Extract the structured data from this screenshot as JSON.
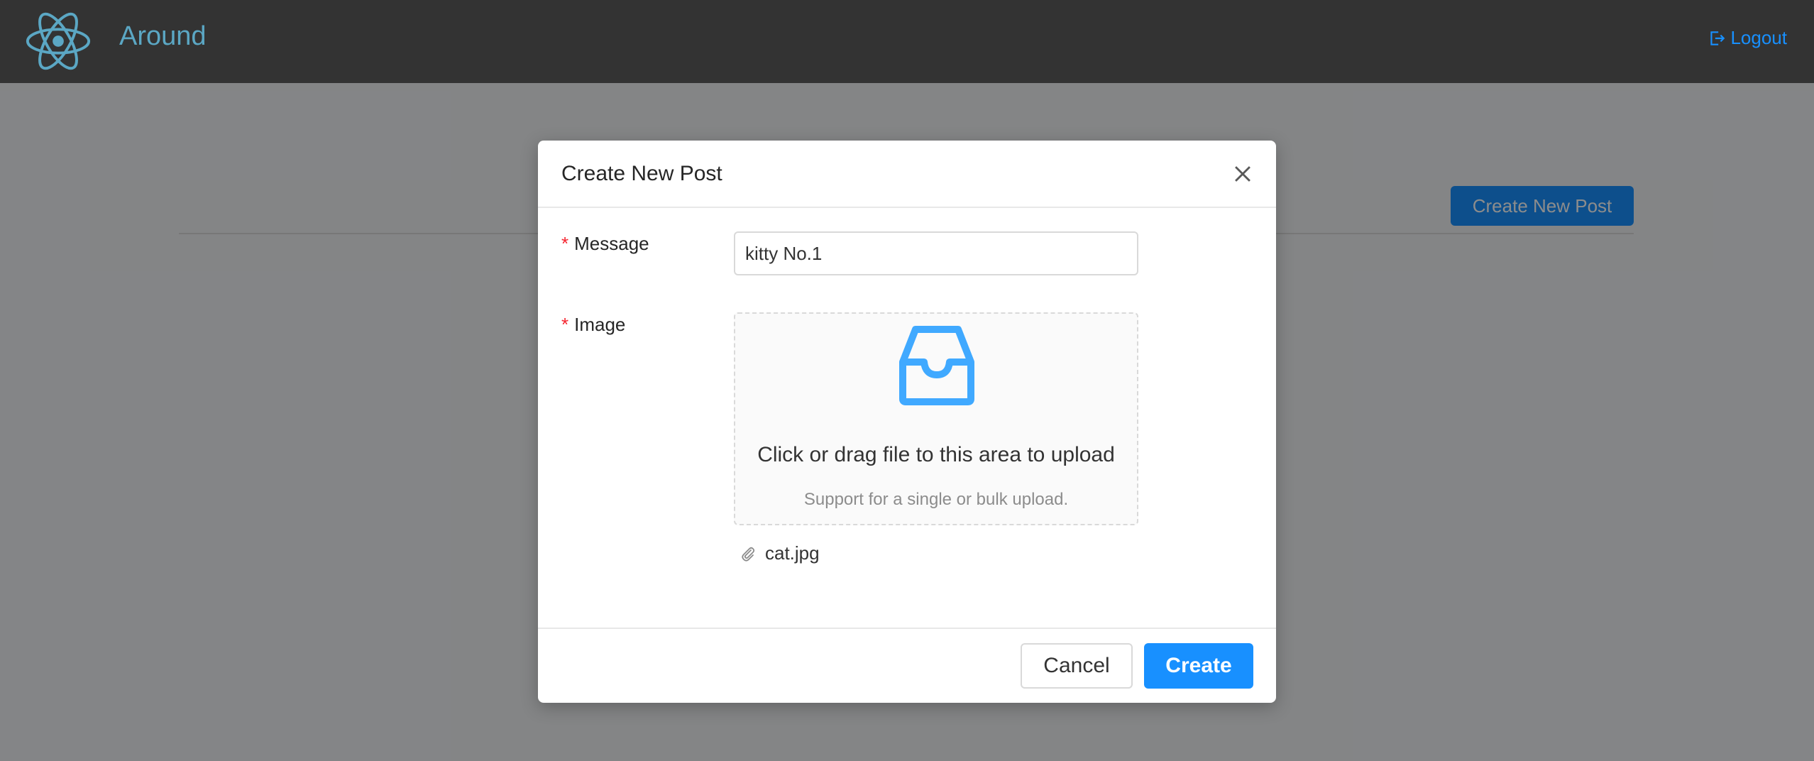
{
  "header": {
    "app_title": "Around",
    "logout_label": "Logout"
  },
  "page": {
    "create_button_label": "Create New Post"
  },
  "modal": {
    "title": "Create New Post",
    "message": {
      "label": "Message",
      "value": "kitty No.1"
    },
    "image": {
      "label": "Image",
      "drop_text": "Click or drag file to this area to upload",
      "drop_hint": "Support for a single or bulk upload.",
      "files": [
        "cat.jpg"
      ]
    },
    "cancel_label": "Cancel",
    "create_label": "Create"
  },
  "colors": {
    "header_bg": "#333333",
    "brand": "#5ba7c4",
    "primary": "#1890ff",
    "required": "#f5222d"
  },
  "icons": [
    "react-atom-logo-icon",
    "logout-icon",
    "close-icon",
    "inbox-icon",
    "paperclip-icon"
  ]
}
